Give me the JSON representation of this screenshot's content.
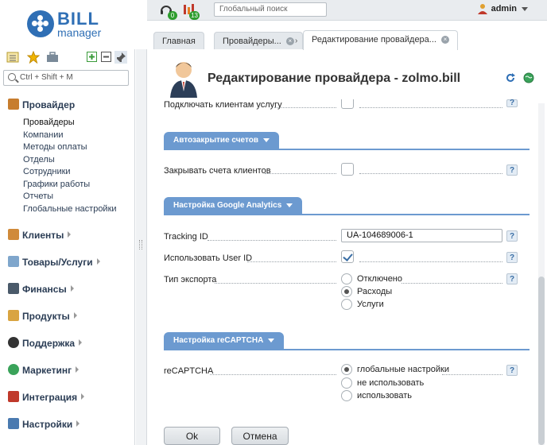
{
  "brand": {
    "bill": "BILL",
    "manager": "manager"
  },
  "topbar": {
    "notif_left_count": "0",
    "notif_right_count": "13",
    "global_search_placeholder": "Глобальный поиск",
    "user_name": "admin"
  },
  "tabs": [
    {
      "label": "Главная"
    },
    {
      "label": "Провайдеры..."
    },
    {
      "label": "Редактирование провайдера..."
    }
  ],
  "sidebar": {
    "search_placeholder": "Ctrl + Shift + M",
    "sections": [
      {
        "label": "Провайдер",
        "expanded": true,
        "items": [
          "Провайдеры",
          "Компании",
          "Методы оплаты",
          "Отделы",
          "Сотрудники",
          "Графики работы",
          "Отчеты",
          "Глобальные настройки"
        ]
      },
      {
        "label": "Клиенты"
      },
      {
        "label": "Товары/Услуги"
      },
      {
        "label": "Финансы"
      },
      {
        "label": "Продукты"
      },
      {
        "label": "Поддержка"
      },
      {
        "label": "Маркетинг"
      },
      {
        "label": "Интеграция"
      },
      {
        "label": "Настройки"
      }
    ]
  },
  "page": {
    "title": "Редактирование провайдера - zolmo.bill"
  },
  "form": {
    "connect_clients_label": "Подключать клиентам услугу",
    "connect_clients_checked": false,
    "autoclose_section": "Автозакрытие счетов",
    "close_invoices_label": "Закрывать счета клиентов",
    "close_invoices_checked": false,
    "ga_section": "Настройка Google Analytics",
    "tracking_id_label": "Tracking ID",
    "tracking_id_value": "UA-104689006-1",
    "use_user_id_label": "Использовать User ID",
    "use_user_id_checked": true,
    "export_type_label": "Тип экспорта",
    "export_options": [
      "Отключено",
      "Расходы",
      "Услуги"
    ],
    "export_selected": "Расходы",
    "recaptcha_section": "Настройка reCAPTCHA",
    "recaptcha_label": "reCAPTCHA",
    "recaptcha_options": [
      "глобальные настройки",
      "не использовать",
      "использовать"
    ],
    "recaptcha_selected": "глобальные настройки",
    "help_symbol": "?"
  },
  "buttons": {
    "ok": "Ok",
    "cancel": "Отмена"
  },
  "colors": {
    "accent": "#6c9ad0",
    "brand": "#2f6fb5",
    "badge": "#2e9d2e"
  }
}
